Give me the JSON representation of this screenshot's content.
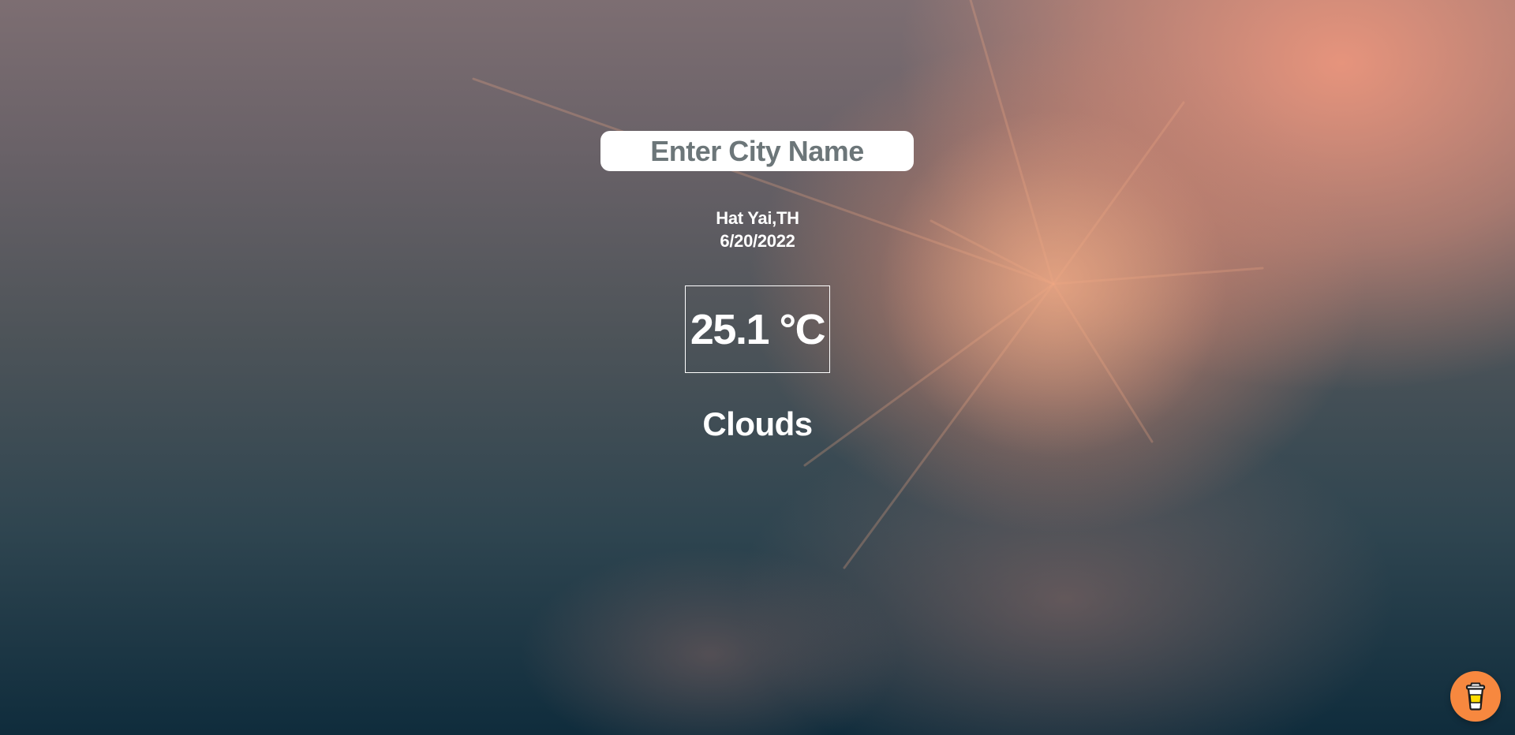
{
  "search": {
    "placeholder": "Enter City Name",
    "value": ""
  },
  "location": {
    "city": "Hat Yai,TH",
    "date": "6/20/2022"
  },
  "weather": {
    "temperature": "25.1 °C",
    "condition": "Clouds"
  },
  "widget": {
    "icon": "coffee-cup-icon",
    "color": "#f7883f"
  }
}
